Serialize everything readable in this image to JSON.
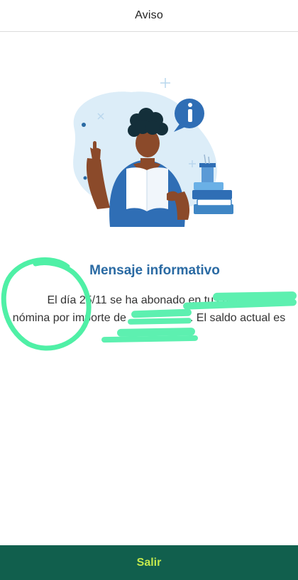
{
  "header": {
    "title": "Aviso"
  },
  "message": {
    "title": "Mensaje informativo",
    "line1": "El día 25/11 se ha abonado en tu cuenta",
    "line2": "nómina por importe de",
    "line2_tail": ". El saldo actual es"
  },
  "footer": {
    "exit_label": "Salir"
  },
  "colors": {
    "accent_blue": "#2a6aa3",
    "footer_bg": "#115f4d",
    "footer_text": "#c3e84d",
    "highlight_marker": "#5df0b0"
  }
}
